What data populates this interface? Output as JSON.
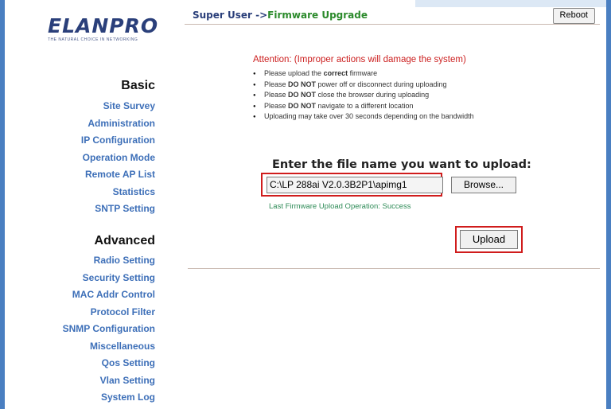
{
  "logo": {
    "text": "ELANPRO",
    "tagline": "THE NATURAL CHOICE IN NETWORKING"
  },
  "sidebar": {
    "basic_heading": "Basic",
    "basic_items": [
      "Site Survey",
      "Administration",
      "IP Configuration",
      "Operation Mode",
      "Remote AP List",
      "Statistics",
      "SNTP Setting"
    ],
    "advanced_heading": "Advanced",
    "advanced_items": [
      "Radio Setting",
      "Security Setting",
      "MAC Addr Control",
      "Protocol Filter",
      "SNMP Configuration",
      "Miscellaneous",
      "Qos Setting",
      "Vlan Setting",
      "System Log"
    ]
  },
  "header": {
    "user": "Super User ->",
    "page": "Firmware Upgrade",
    "reboot_label": "Reboot"
  },
  "notice": {
    "attention": "Attention: (Improper actions will damage the system)",
    "bullets": [
      "Please upload the correct firmware",
      "Please DO NOT power off or disconnect during uploading",
      "Please DO NOT close the browser during uploading",
      "Please DO NOT navigate to a different location",
      "Uploading may take over 30 seconds depending on the bandwidth"
    ]
  },
  "upload": {
    "prompt": "Enter the file name you want to upload:",
    "file_value": "C:\\LP 288ai V2.0.3B2P1\\apimg1",
    "browse_label": "Browse...",
    "status": "Last Firmware Upload Operation: Success",
    "upload_label": "Upload"
  },
  "colors": {
    "frame": "#4a7fc1",
    "nav_link": "#3d6fb8",
    "attention": "#cc1f1f",
    "status": "#2e8b57",
    "highlight": "#d01c1c"
  }
}
